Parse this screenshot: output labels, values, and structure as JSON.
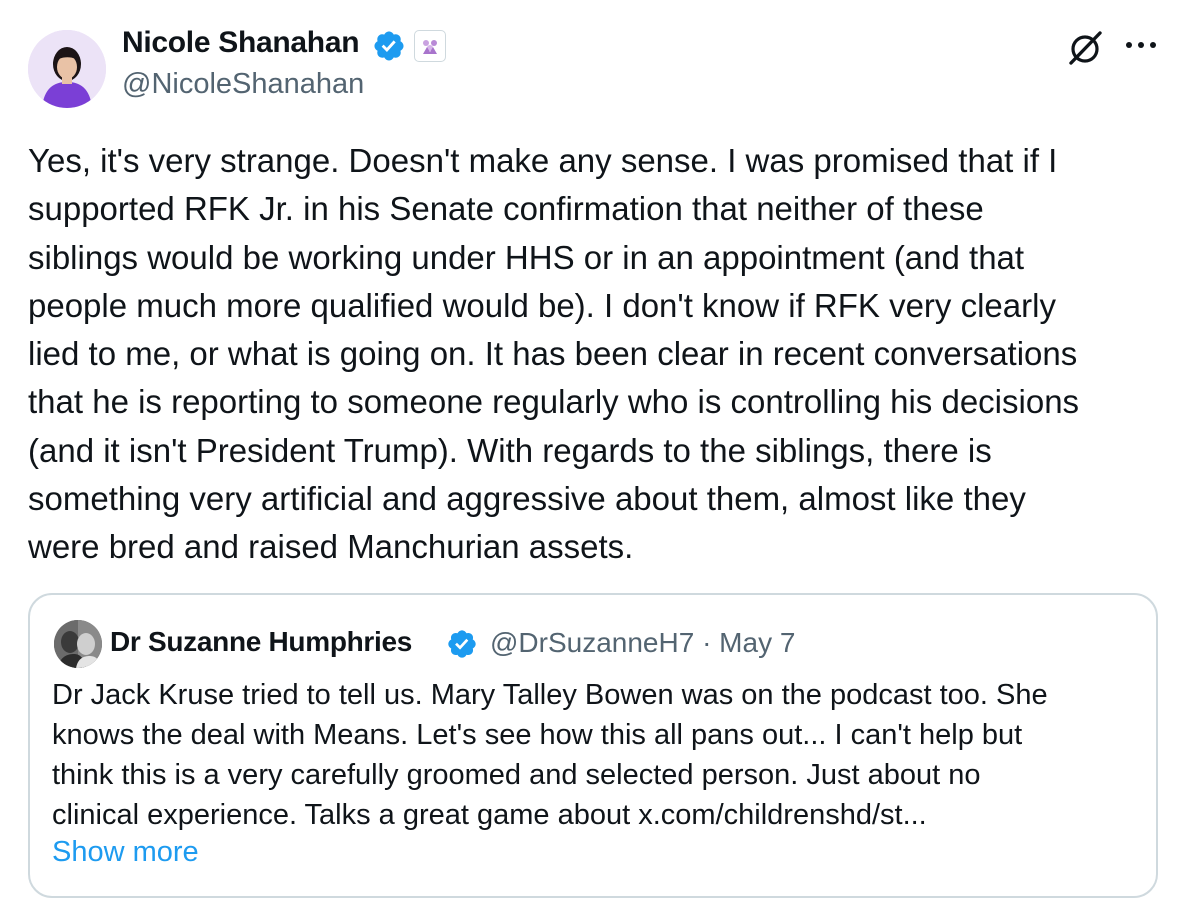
{
  "tweet": {
    "author": {
      "name": "Nicole Shanahan",
      "handle": "@NicoleShanahan"
    },
    "text_lines": [
      "Yes, it's very strange. Doesn't make any sense. I was promised that if I",
      "supported RFK Jr. in his Senate confirmation that neither of these",
      "siblings would be working under HHS or in an appointment (and that",
      "people much more qualified would be). I don't know if RFK very clearly",
      "lied to me, or what is going on. It has been clear in recent conversations",
      "that he is reporting to someone regularly who is controlling his decisions",
      "(and it isn't President Trump). With regards to the siblings, there is",
      "something very artificial and aggressive about them, almost like they",
      "were bred and raised Manchurian assets."
    ]
  },
  "quoted_tweet": {
    "author": {
      "name": "Dr Suzanne Humphries",
      "meta": "@DrSuzanneH7 · May 7"
    },
    "text_lines": [
      "Dr Jack Kruse tried to tell us. Mary Talley Bowen was on the podcast too. She",
      "knows the deal with Means. Let's see how this all pans out... I can't help but",
      "think this is a very carefully groomed and selected person. Just about no",
      "clinical experience. Talks a great game about x.com/childrenshd/st..."
    ],
    "show_more_label": "Show more"
  },
  "icons": {
    "verified": "verified-badge-icon",
    "affiliate": "affiliate-badge-icon",
    "grok": "grok-icon",
    "more": "more-options-icon"
  },
  "colors": {
    "text": "#0f1419",
    "secondary": "#536471",
    "link": "#1d9bf0",
    "border": "#cfd9de"
  }
}
